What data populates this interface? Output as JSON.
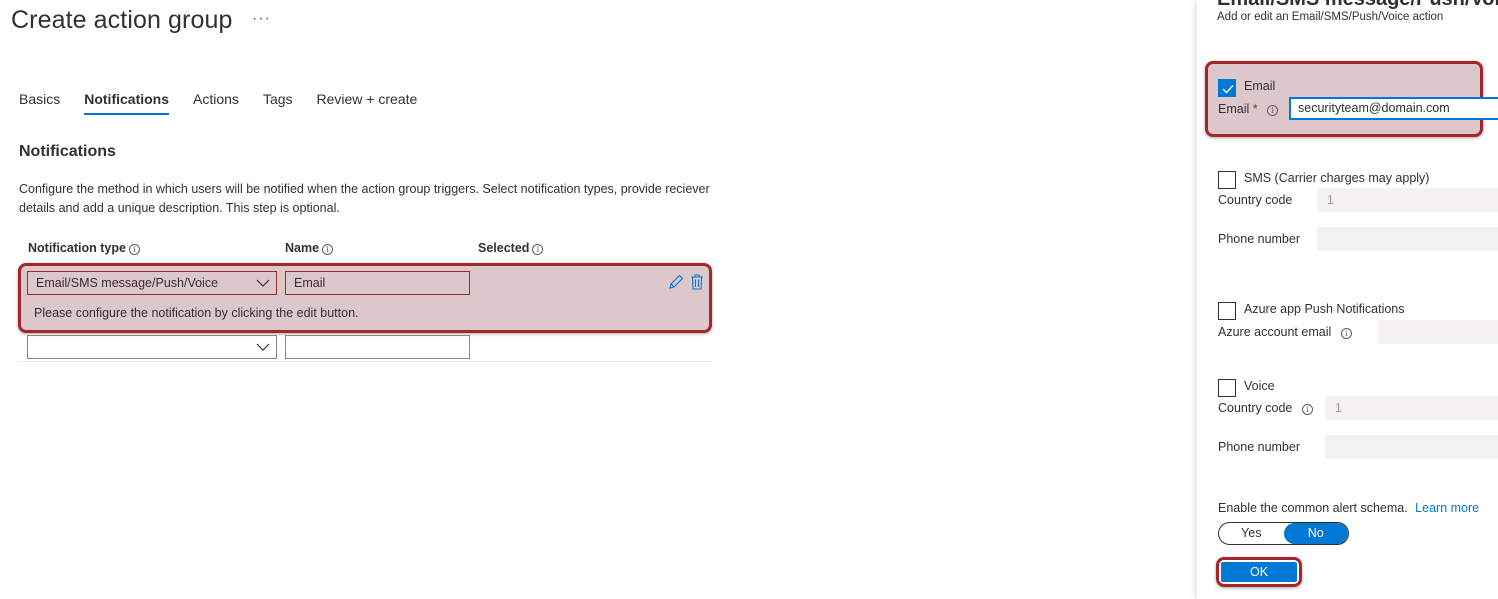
{
  "header": {
    "title": "Create action group",
    "more": "···"
  },
  "tabs": [
    {
      "label": "Basics",
      "active": false
    },
    {
      "label": "Notifications",
      "active": true
    },
    {
      "label": "Actions",
      "active": false
    },
    {
      "label": "Tags",
      "active": false
    },
    {
      "label": "Review + create",
      "active": false
    }
  ],
  "notifications": {
    "title": "Notifications",
    "description": "Configure the method in which users will be notified when the action group triggers. Select notification types, provide reciever details and add a unique description. This step is optional.",
    "columns": {
      "type": "Notification type",
      "name": "Name",
      "selected": "Selected"
    },
    "row": {
      "type_value": "Email/SMS message/Push/Voice",
      "name_value": "Email",
      "message": "Please configure the notification by clicking the edit button."
    },
    "new_row": {
      "type_value": "",
      "name_value": ""
    }
  },
  "panel": {
    "title": "Email/SMS message/Push/Voice",
    "subtitle": "Add or edit an Email/SMS/Push/Voice action",
    "email": {
      "checkbox_label": "Email",
      "field_label": "Email",
      "required": "*",
      "value": "securityteam@domain.com",
      "checked": true
    },
    "sms": {
      "checkbox_label": "SMS (Carrier charges may apply)",
      "country_label": "Country code",
      "country_value": "1",
      "phone_label": "Phone number",
      "phone_value": ""
    },
    "push": {
      "checkbox_label": "Azure app Push Notifications",
      "account_label": "Azure account email",
      "account_value": ""
    },
    "voice": {
      "checkbox_label": "Voice",
      "country_label": "Country code",
      "country_value": "1",
      "phone_label": "Phone number",
      "phone_value": ""
    },
    "schema": {
      "label": "Enable the common alert schema.",
      "learn_more": "Learn more",
      "yes": "Yes",
      "no": "No",
      "selected": "No"
    },
    "ok": "OK"
  },
  "colors": {
    "accent": "#0078d4",
    "highlight_border": "#a4262c",
    "highlight_fill": "#dcc8ca"
  },
  "icons": [
    "info-icon",
    "chevron-down-icon",
    "edit-pencil-icon",
    "trash-icon",
    "checkmark-icon"
  ]
}
